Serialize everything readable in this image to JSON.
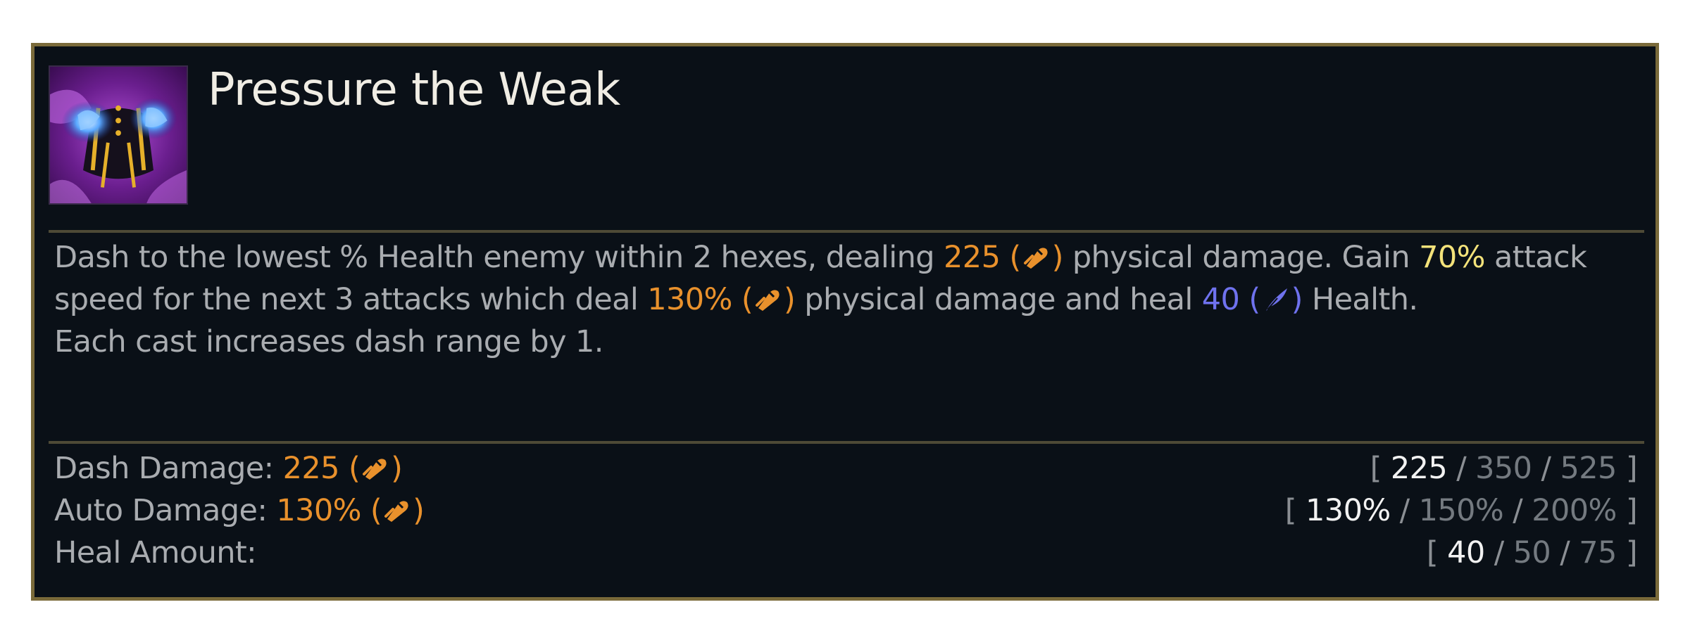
{
  "ability": {
    "name": "Pressure the Weak",
    "icon": "ability-icon-purple-claws"
  },
  "description": {
    "line1": {
      "t1": "Dash to the lowest % Health enemy within 2 hexes, dealing ",
      "v1": "225",
      "t2": " physical damage. Gain ",
      "v2": "70%",
      "t3": " attack"
    },
    "line2": {
      "t1": "speed for the next 3 attacks which deal ",
      "v1": "130%",
      "t2": " physical damage and heal ",
      "v2": "40",
      "t3": " Health."
    },
    "line3": "Each cast increases dash range by 1."
  },
  "stats": [
    {
      "label": "Dash Damage: ",
      "value": "225",
      "tiers": [
        "225",
        "350",
        "525"
      ]
    },
    {
      "label": "Auto Damage: ",
      "value": "130%",
      "tiers": [
        "130%",
        "150%",
        "200%"
      ]
    },
    {
      "label": "Heal Amount:",
      "value": "",
      "tiers": [
        "40",
        "50",
        "75"
      ]
    }
  ],
  "colors": {
    "background": "#0a1017",
    "border": "#7a6a3a",
    "text": "#a9acb0",
    "attack_damage": "#e9912c",
    "attack_speed": "#f3e27a",
    "ability_power": "#6f72ee"
  },
  "icons": {
    "attack_damage": "attack-damage-icon",
    "ability_power": "ability-power-icon"
  }
}
